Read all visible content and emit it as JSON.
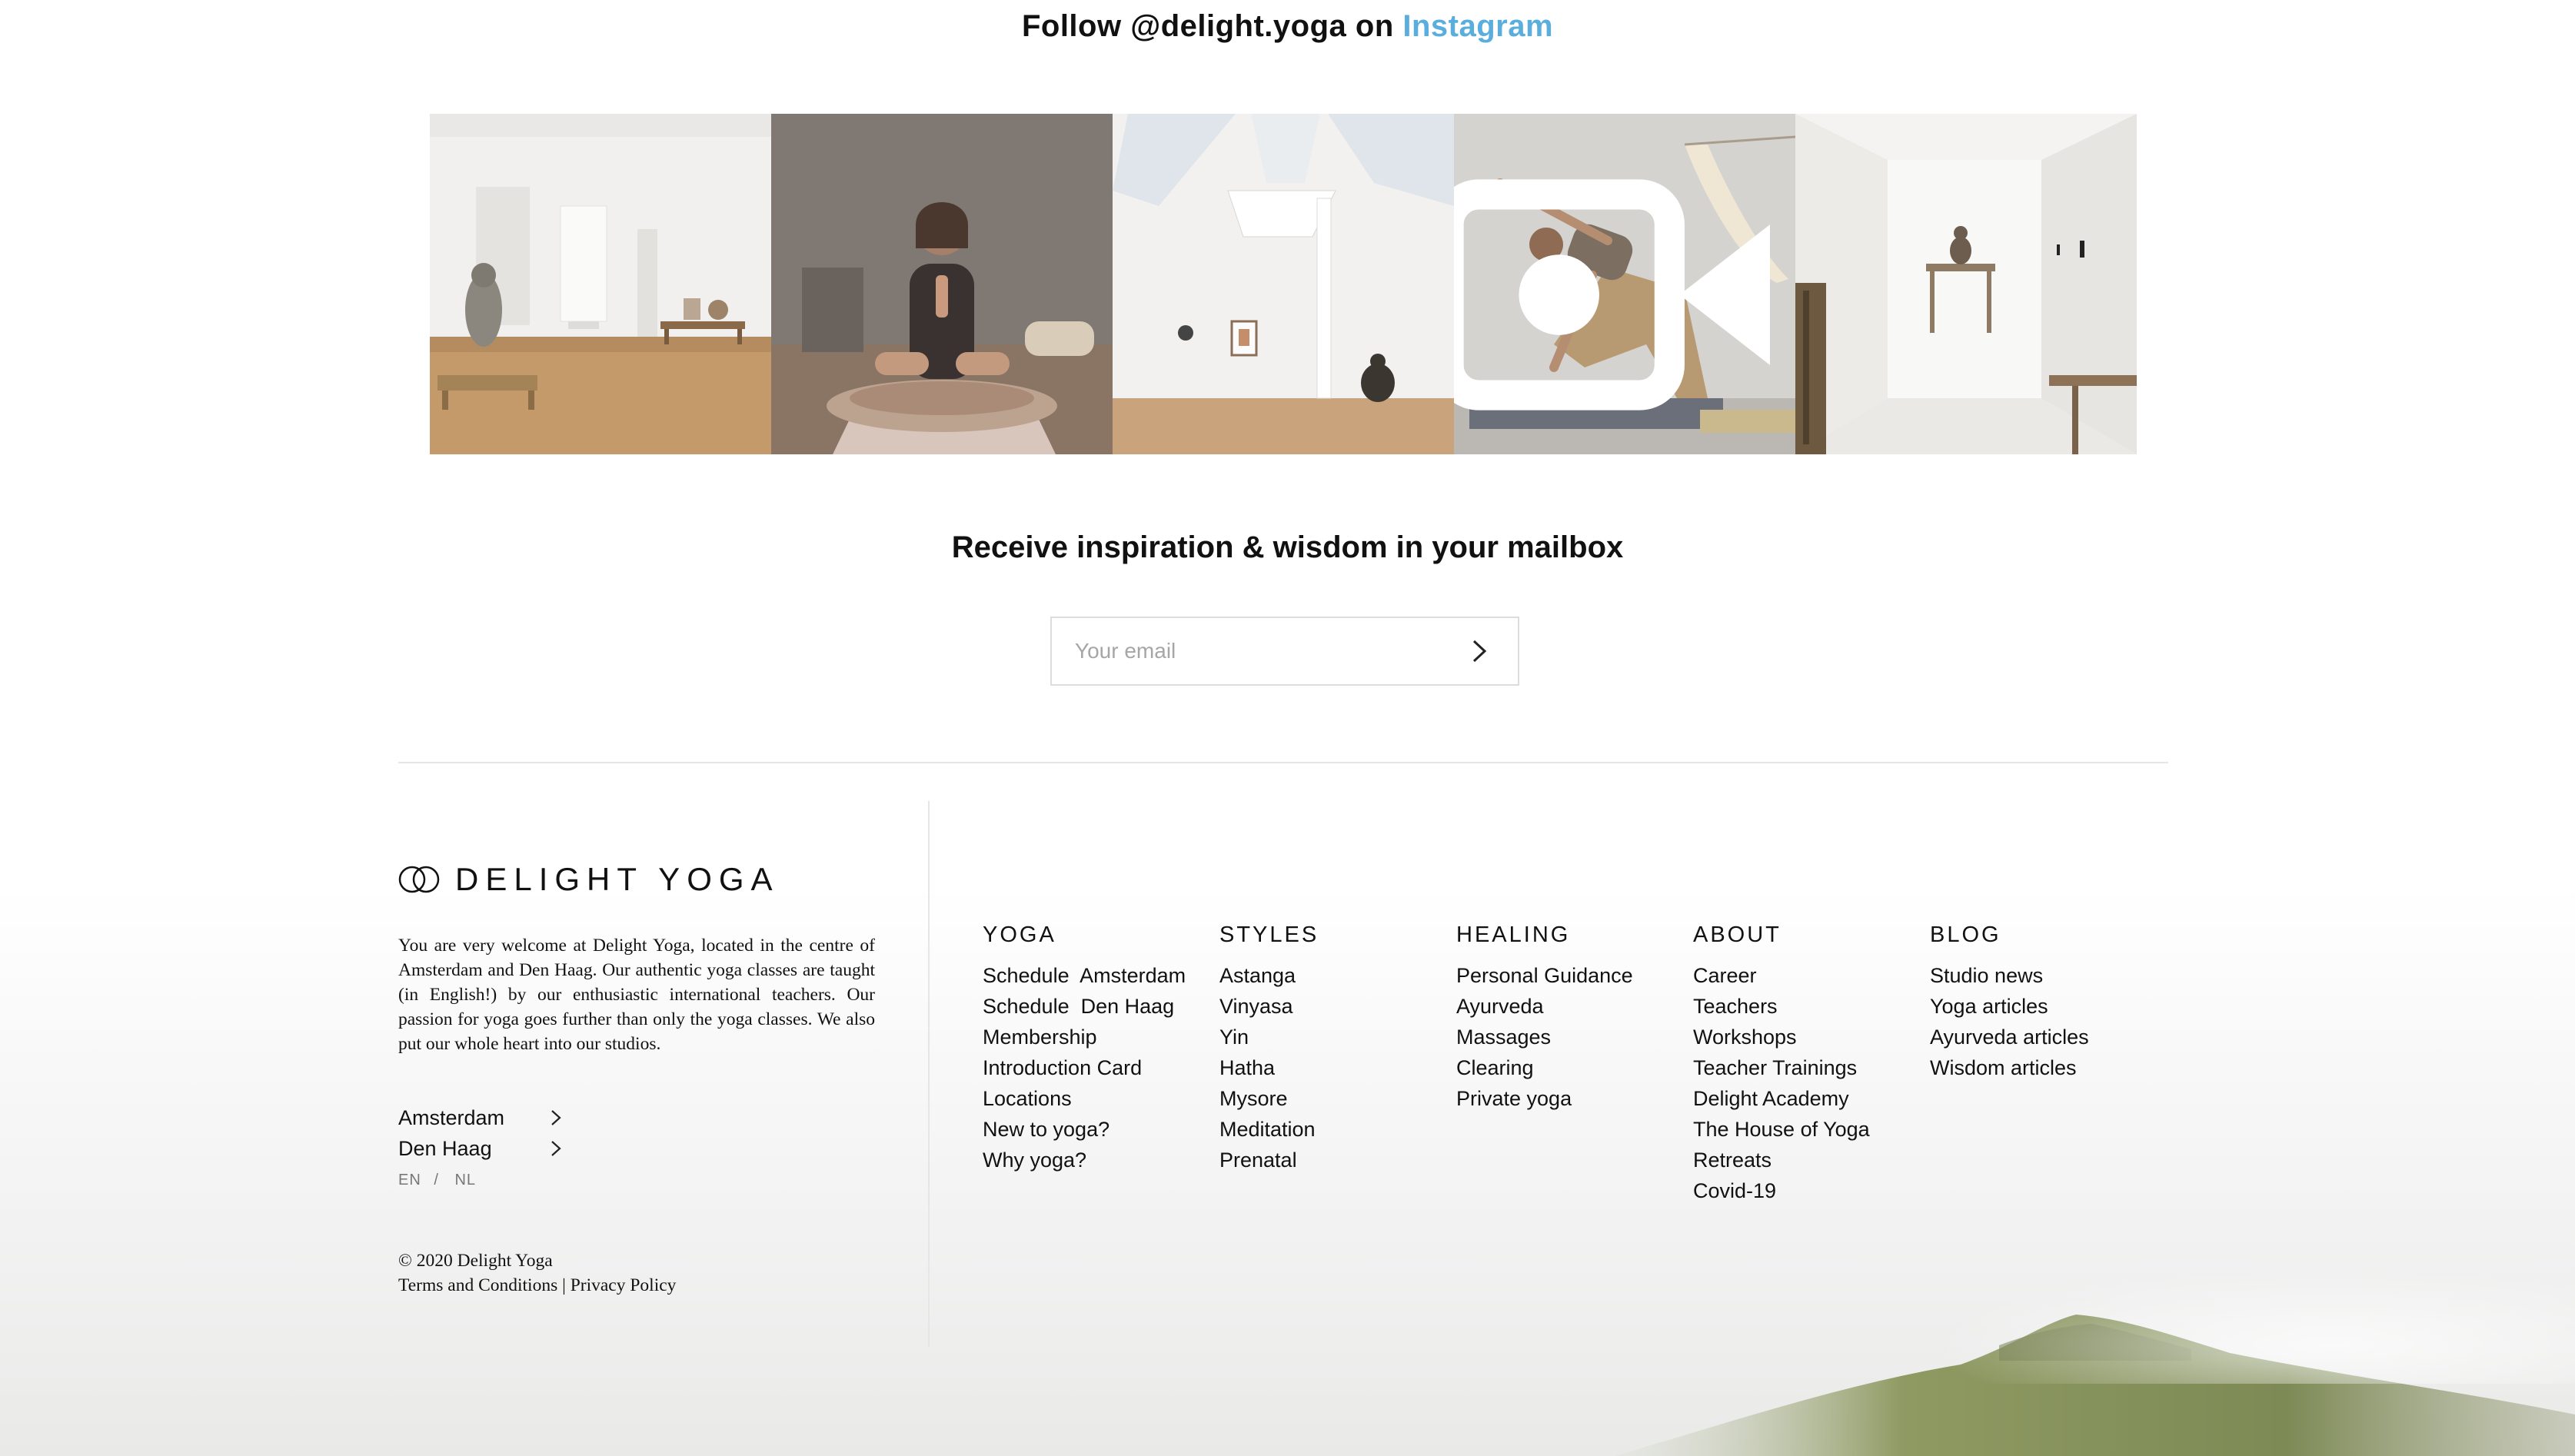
{
  "instagram": {
    "prefix": "Follow @delight.yoga on ",
    "link": "Instagram",
    "accent_color": "#5aaede",
    "photos": [
      {
        "subject": "studio interior with buddha statue"
      },
      {
        "subject": "woman meditating"
      },
      {
        "subject": "studio with skylights"
      },
      {
        "subject": "woman in triangle pose",
        "icon": "video-icon"
      },
      {
        "subject": "hallway with buddha statue"
      }
    ]
  },
  "newsletter": {
    "title": "Receive inspiration & wisdom in your mailbox",
    "email_placeholder": "Your email",
    "email_value": ""
  },
  "brand": {
    "name": "DELIGHT YOGA",
    "about": "You are very welcome at Delight Yoga, located in the centre of Amsterdam and Den Haag. Our authentic yoga classes are taught (in English!) by our enthusiastic international teachers. Our passion for yoga goes further than only the yoga classes. We also put our whole heart into our studios."
  },
  "cities": [
    "Amsterdam",
    "Den Haag"
  ],
  "languages": {
    "en": "EN",
    "separator": "/",
    "nl": "NL"
  },
  "legal": {
    "copyright": "© 2020 Delight Yoga",
    "terms": "Terms and Conditions",
    "separator": "|",
    "privacy": "Privacy Policy"
  },
  "footer_columns": [
    {
      "heading": "YOGA",
      "items": [
        "Schedule  Amsterdam",
        "Schedule  Den Haag",
        "Membership",
        "Introduction Card",
        "Locations",
        "New to yoga?",
        "Why yoga?"
      ]
    },
    {
      "heading": "STYLES",
      "items": [
        "Astanga",
        "Vinyasa",
        "Yin",
        "Hatha",
        "Mysore",
        "Meditation",
        "Prenatal"
      ]
    },
    {
      "heading": "HEALING",
      "items": [
        "Personal Guidance",
        "Ayurveda",
        "Massages",
        "Clearing",
        "Private yoga"
      ]
    },
    {
      "heading": "ABOUT",
      "items": [
        "Career",
        "Teachers",
        "Workshops",
        "Teacher Trainings",
        "Delight Academy",
        "The House of Yoga",
        "Retreats",
        "Covid-19"
      ]
    },
    {
      "heading": "BLOG",
      "items": [
        "Studio news",
        "Yoga articles",
        "Ayurveda articles",
        "Wisdom articles"
      ]
    }
  ]
}
